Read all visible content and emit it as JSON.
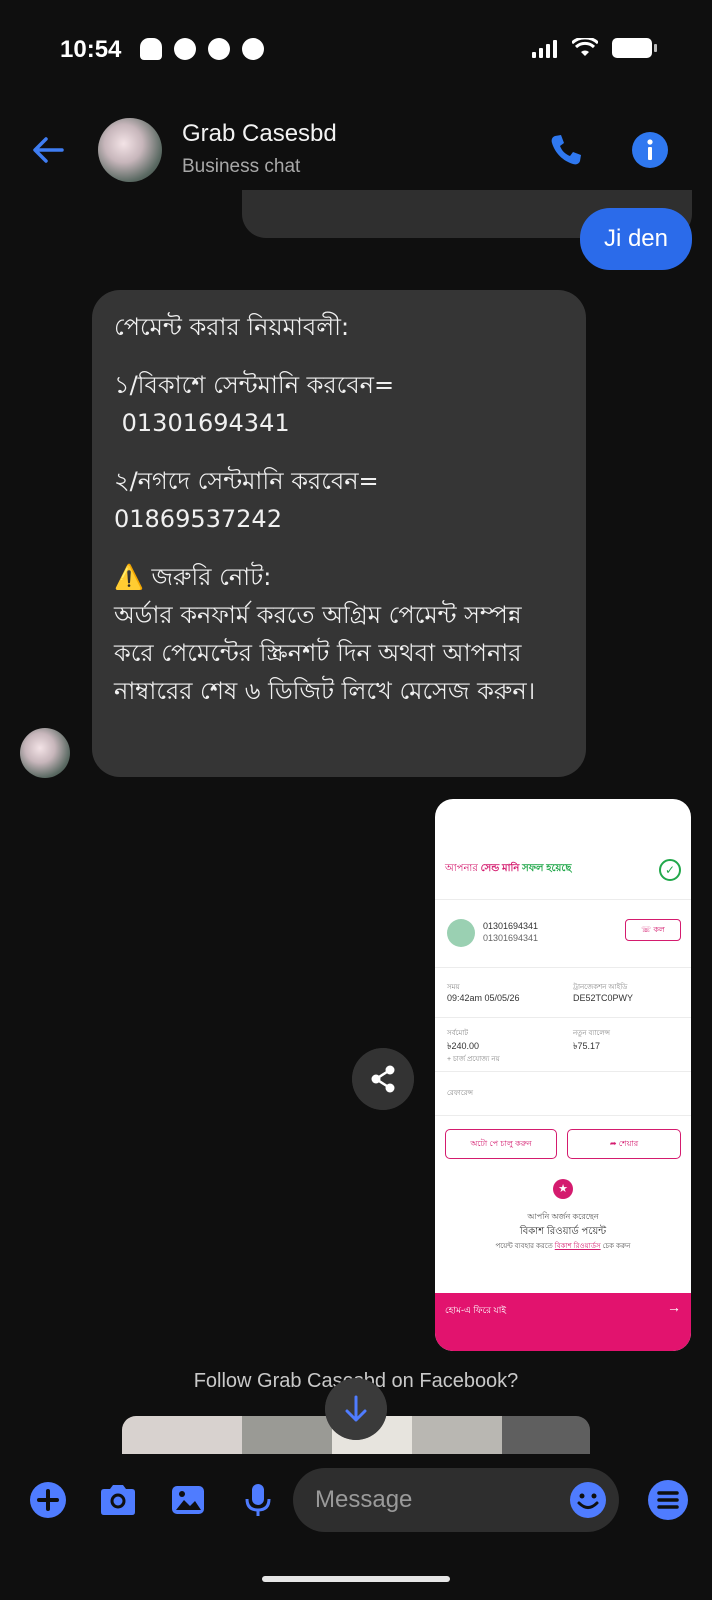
{
  "status_bar": {
    "time": "10:54"
  },
  "header": {
    "title": "Grab Casesbd",
    "subtitle": "Business chat"
  },
  "messages": {
    "sent": "Ji den",
    "received": {
      "heading": "পেমেন্ট করার নিয়মাবলী:",
      "bkash_line": "১/বিকাশে সেন্টমানি  করবেন=",
      "bkash_number": "01301694341",
      "nagad_line": "২/নগদে সেন্টমানি করবেন=",
      "nagad_number": "01869537242",
      "note_title": "⚠️ জরুরি নোট:",
      "note_body": "অর্ডার কনফার্ম করতে অগ্রিম পেমেন্ট সম্পন্ন করে পেমেন্টের স্ক্রিনশট দিন অথবা আপনার নাম্বারের শেষ ৬ ডিজিট লিখে মেসেজ করুন।"
    }
  },
  "screenshot": {
    "title_prefix": "আপনার",
    "title_highlight": "সেন্ড মানি",
    "title_suffix": "সফল হয়েছে",
    "number_1": "01301694341",
    "number_2": "01301694341",
    "call_label": "কল",
    "time_label": "সময়",
    "time_value": "09:42am 05/05/26",
    "txn_label": "ট্রানজেকশন আইডি",
    "txn_value": "DE52TC0PWY",
    "total_label": "সর্বমোট",
    "total_value": "৳240.00",
    "charge_note": "+ চার্জ প্রযোজ্য নয়",
    "balance_label": "নতুন ব্যালেন্স",
    "balance_value": "৳75.17",
    "reference_label": "রেফারেন্স",
    "autopay_button": "অটো পে চালু করুন",
    "share_button": "শেয়ার",
    "reward_line1": "আপনি অর্জন করেছেন",
    "reward_line2": "বিকাশ রিওয়ার্ড পয়েন্ট",
    "reward_line3_prefix": "পয়েন্ট ব্যবহার করতে",
    "reward_line3_link": "বিকাশ রিওয়ার্ডস",
    "reward_line3_suffix": "চেক করুন",
    "home_button": "হোম-এ ফিরে যাই"
  },
  "follow_text": "Follow Grab Casesbd on Facebook?",
  "composer": {
    "placeholder": "Message"
  },
  "colors": {
    "accent": "#2b6bea",
    "icon_blue": "#4f7cff",
    "bkash_pink": "#e2136e",
    "received_bubble": "#353535"
  },
  "icons": [
    "add-icon",
    "camera-icon",
    "gallery-icon",
    "mic-icon",
    "emoji-icon",
    "menu-icon",
    "phone-icon",
    "info-icon",
    "back-arrow-icon",
    "share-icon",
    "arrow-down-icon"
  ]
}
